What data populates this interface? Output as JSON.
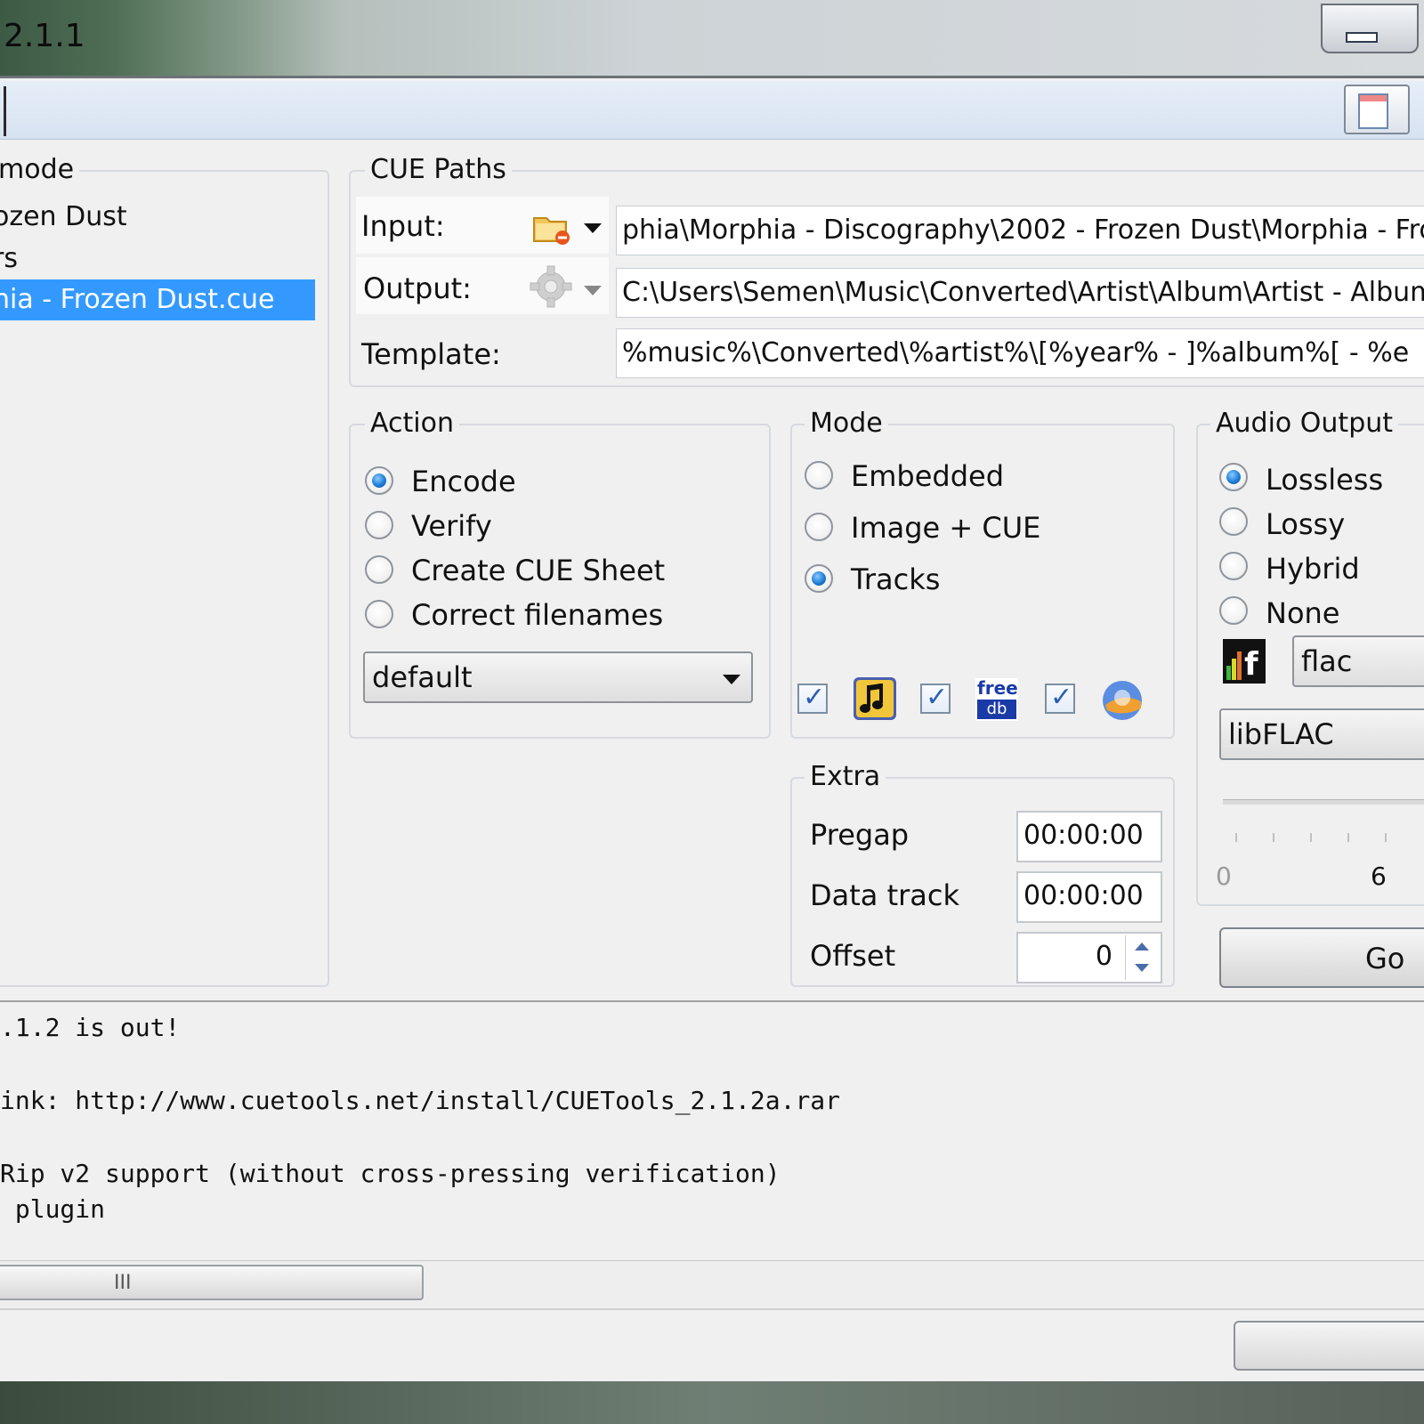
{
  "window": {
    "title": "2.1.1"
  },
  "tree": {
    "legend": "mode",
    "items": [
      "ozen Dust",
      "rs",
      "hia - Frozen Dust.cue"
    ]
  },
  "cue_paths": {
    "legend": "CUE Paths",
    "input_label": "Input:",
    "input_value": "phia\\Morphia - Discography\\2002 - Frozen Dust\\Morphia - Froz",
    "output_label": "Output:",
    "output_value": "C:\\Users\\Semen\\Music\\Converted\\Artist\\Album\\Artist - Album.",
    "template_label": "Template:",
    "template_value": "%music%\\Converted\\%artist%\\[%year% - ]%album%[ - %e"
  },
  "action": {
    "legend": "Action",
    "options": [
      "Encode",
      "Verify",
      "Create CUE Sheet",
      "Correct filenames"
    ],
    "selected": "Encode",
    "script_select": "default"
  },
  "mode": {
    "legend": "Mode",
    "options": [
      "Embedded",
      "Image + CUE",
      "Tracks"
    ],
    "selected": "Tracks",
    "freedb_icon_text_top": "free",
    "freedb_icon_text_bottom": "db"
  },
  "audio_output": {
    "legend": "Audio Output",
    "options": [
      "Lossless",
      "Lossy",
      "Hybrid",
      "None"
    ],
    "selected": "Lossless",
    "format": "flac",
    "encoder": "libFLAC",
    "slider_min": "0",
    "slider_tick": "6",
    "go_button": "Go"
  },
  "extra": {
    "legend": "Extra",
    "pregap_label": "Pregap",
    "pregap_value": "00:00:00",
    "datatrack_label": "Data track",
    "datatrack_value": "00:00:00",
    "offset_label": "Offset",
    "offset_value": "0"
  },
  "log": {
    "lines": [
      ".1.2 is out!",
      "ink: http://www.cuetools.net/install/CUETools_2.1.2a.rar",
      "Rip v2 support (without cross-pressing verification)",
      " plugin"
    ]
  },
  "scrollbar": {
    "grip": "III"
  }
}
